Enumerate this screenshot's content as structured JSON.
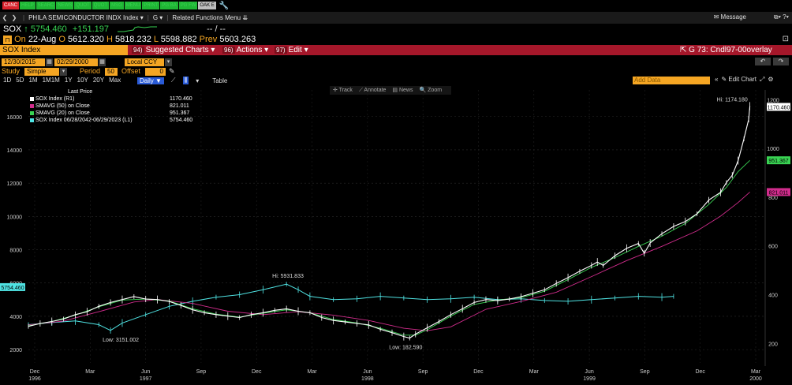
{
  "fkeys": [
    {
      "label": "CANC",
      "color": "red"
    },
    {
      "label": "HELP",
      "color": "green"
    },
    {
      "label": "SEARC",
      "color": "green"
    },
    {
      "label": "NEWS",
      "color": "green"
    },
    {
      "label": "QUOT",
      "color": "green"
    },
    {
      "label": "QUOT",
      "color": "green"
    },
    {
      "label": "MSG",
      "color": "green"
    },
    {
      "label": "MENU",
      "color": "green"
    },
    {
      "label": "PRINT",
      "color": "green"
    },
    {
      "label": "PG BA",
      "color": "green"
    },
    {
      "label": "PG FW",
      "color": "green"
    },
    {
      "label": "OAK E",
      "color": "grey"
    }
  ],
  "menubar": {
    "security": "PHILA SEMICONDUCTOR INDX Index ▾",
    "g_menu": "G ▾",
    "related": "Related Functions Menu ⇊",
    "message": "Message",
    "window_icons": "⧉▾ ?▾"
  },
  "ticker": {
    "symbol": "SOX",
    "arrow": "↑",
    "last": "5754.460",
    "change": "+151.197",
    "bid_ask": "-- / --",
    "on_label": "On",
    "date": "22-Aug",
    "o_label": "O",
    "open": "5612.320",
    "h_label": "H",
    "high": "5818.232",
    "l_label": "L",
    "low": "5598.882",
    "prev_label": "Prev",
    "prev": "5603.263"
  },
  "toolbar": {
    "security_name": "SOX Index",
    "btn1_num": "94)",
    "btn1": "Suggested Charts ▾",
    "btn2_num": "96)",
    "btn2": "Actions ▾",
    "btn3_num": "97)",
    "btn3": "Edit ▾",
    "chart_id": "G 73: Cndl97-00overlay"
  },
  "daterow": {
    "start": "12/30/2015",
    "end": "02/29/2000",
    "currency": "Local CCY"
  },
  "studyrow": {
    "study_label": "Study",
    "study": "Simple MA",
    "period_label": "Period",
    "period": "50",
    "offset_label": "Offset",
    "offset": "0"
  },
  "periods": [
    "1D",
    "5D",
    "1M",
    "1M1M",
    "1Y",
    "10Y",
    "20Y",
    "Max"
  ],
  "frequency": "Daily ▼",
  "table_label": "Table",
  "add_data": "Add Data",
  "edit_chart": "Edit Chart",
  "tools": [
    "✛ Track",
    "⟋ Annotate",
    "▤ News",
    "🔍 Zoom"
  ],
  "legend": {
    "title": "Last Price",
    "rows": [
      {
        "name": "SOX Index (R1)",
        "value": "1170.460",
        "color": "#ffffff"
      },
      {
        "name": "SMAVG (50) on Close",
        "value": "821.011",
        "color": "#d12c8c"
      },
      {
        "name": "SMAVG (20) on Close",
        "value": "951.367",
        "color": "#39d353"
      },
      {
        "name": "SOX Index 06/28/2042-06/29/2023 (L1)",
        "value": "5754.460",
        "color": "#4fe3e3"
      }
    ]
  },
  "chart_data": {
    "type": "line",
    "left_axis": {
      "ticks": [
        2000,
        4000,
        6000,
        8000,
        10000,
        12000,
        14000,
        16000
      ],
      "range": [
        1200,
        17600
      ],
      "current": "5754.460",
      "current_value": 5754.46
    },
    "right_axis": {
      "ticks": [
        200,
        400,
        600,
        800,
        1000,
        1200
      ],
      "range": [
        120,
        1240
      ],
      "tags": [
        {
          "label": "1170.460",
          "value": 1170.46,
          "color": "#ffffff"
        },
        {
          "label": "951.367",
          "value": 951.367,
          "color": "#39d353"
        },
        {
          "label": "821.011",
          "value": 821.011,
          "color": "#d12c8c"
        }
      ]
    },
    "x_labels": [
      {
        "m": "Dec",
        "y": "1996"
      },
      {
        "m": "Mar",
        "y": ""
      },
      {
        "m": "Jun",
        "y": "1997"
      },
      {
        "m": "Sep",
        "y": ""
      },
      {
        "m": "Dec",
        "y": ""
      },
      {
        "m": "Mar",
        "y": ""
      },
      {
        "m": "Jun",
        "y": "1998"
      },
      {
        "m": "Sep",
        "y": ""
      },
      {
        "m": "Dec",
        "y": ""
      },
      {
        "m": "Mar",
        "y": ""
      },
      {
        "m": "Jun",
        "y": "1999"
      },
      {
        "m": "Sep",
        "y": ""
      },
      {
        "m": "Dec",
        "y": ""
      },
      {
        "m": "Mar",
        "y": "2000"
      }
    ],
    "series": [
      {
        "name": "SOX Index (R1)",
        "axis": "right",
        "color": "#ffffff",
        "values": [
          [
            0,
            270
          ],
          [
            2,
            282
          ],
          [
            4,
            290
          ],
          [
            6,
            300
          ],
          [
            8,
            318
          ],
          [
            10,
            330
          ],
          [
            12,
            352
          ],
          [
            14,
            368
          ],
          [
            16,
            380
          ],
          [
            18,
            392
          ],
          [
            20,
            382
          ],
          [
            22,
            380
          ],
          [
            24,
            372
          ],
          [
            26,
            356
          ],
          [
            28,
            338
          ],
          [
            30,
            326
          ],
          [
            32,
            318
          ],
          [
            34,
            312
          ],
          [
            36,
            306
          ],
          [
            38,
            318
          ],
          [
            40,
            326
          ],
          [
            42,
            336
          ],
          [
            44,
            342
          ],
          [
            46,
            332
          ],
          [
            48,
            326
          ],
          [
            50,
            306
          ],
          [
            52,
            294
          ],
          [
            54,
            288
          ],
          [
            56,
            282
          ],
          [
            58,
            276
          ],
          [
            60,
            258
          ],
          [
            62,
            244
          ],
          [
            64,
            228
          ],
          [
            65,
            222
          ],
          [
            66,
            238
          ],
          [
            68,
            264
          ],
          [
            70,
            290
          ],
          [
            72,
            318
          ],
          [
            74,
            342
          ],
          [
            76,
            368
          ],
          [
            78,
            380
          ],
          [
            80,
            376
          ],
          [
            82,
            382
          ],
          [
            84,
            392
          ],
          [
            86,
            406
          ],
          [
            88,
            420
          ],
          [
            90,
            446
          ],
          [
            92,
            470
          ],
          [
            94,
            496
          ],
          [
            96,
            520
          ],
          [
            97,
            534
          ],
          [
            98,
            520
          ],
          [
            100,
            560
          ],
          [
            102,
            590
          ],
          [
            104,
            610
          ],
          [
            105,
            570
          ],
          [
            106,
            612
          ],
          [
            108,
            650
          ],
          [
            110,
            680
          ],
          [
            112,
            700
          ],
          [
            114,
            732
          ],
          [
            116,
            788
          ],
          [
            118,
            820
          ],
          [
            119,
            860
          ],
          [
            120,
            890
          ],
          [
            121,
            950
          ],
          [
            122,
            1040
          ],
          [
            122.8,
            1120
          ],
          [
            123,
            1174
          ]
        ]
      },
      {
        "name": "SMAVG (20) on Close",
        "axis": "right",
        "color": "#39d353",
        "values": [
          [
            0,
            272
          ],
          [
            4,
            290
          ],
          [
            8,
            316
          ],
          [
            12,
            350
          ],
          [
            16,
            378
          ],
          [
            20,
            382
          ],
          [
            24,
            374
          ],
          [
            28,
            342
          ],
          [
            32,
            320
          ],
          [
            36,
            308
          ],
          [
            40,
            324
          ],
          [
            44,
            338
          ],
          [
            48,
            326
          ],
          [
            52,
            298
          ],
          [
            56,
            284
          ],
          [
            60,
            262
          ],
          [
            64,
            234
          ],
          [
            66,
            234
          ],
          [
            68,
            256
          ],
          [
            72,
            312
          ],
          [
            76,
            360
          ],
          [
            80,
            378
          ],
          [
            84,
            388
          ],
          [
            88,
            414
          ],
          [
            92,
            462
          ],
          [
            96,
            512
          ],
          [
            100,
            552
          ],
          [
            104,
            598
          ],
          [
            108,
            640
          ],
          [
            112,
            692
          ],
          [
            116,
            770
          ],
          [
            119,
            840
          ],
          [
            121,
            905
          ],
          [
            123,
            951
          ]
        ]
      },
      {
        "name": "SMAVG (50) on Close",
        "axis": "right",
        "color": "#d12c8c",
        "values": [
          [
            0,
            276
          ],
          [
            6,
            292
          ],
          [
            12,
            330
          ],
          [
            18,
            370
          ],
          [
            22,
            380
          ],
          [
            28,
            364
          ],
          [
            34,
            332
          ],
          [
            40,
            318
          ],
          [
            46,
            330
          ],
          [
            52,
            316
          ],
          [
            58,
            294
          ],
          [
            64,
            262
          ],
          [
            68,
            252
          ],
          [
            72,
            268
          ],
          [
            78,
            340
          ],
          [
            84,
            372
          ],
          [
            90,
            410
          ],
          [
            96,
            474
          ],
          [
            102,
            540
          ],
          [
            108,
            598
          ],
          [
            114,
            662
          ],
          [
            118,
            722
          ],
          [
            121,
            778
          ],
          [
            123,
            821
          ]
        ]
      },
      {
        "name": "SOX Index 06/28/2042-06/29/2023 (L1)",
        "axis": "left",
        "color": "#4fe3e3",
        "values": [
          [
            0,
            3500
          ],
          [
            4,
            3620
          ],
          [
            8,
            3720
          ],
          [
            12,
            3500
          ],
          [
            14,
            3151
          ],
          [
            16,
            3600
          ],
          [
            20,
            4100
          ],
          [
            24,
            4600
          ],
          [
            28,
            4900
          ],
          [
            32,
            5150
          ],
          [
            36,
            5300
          ],
          [
            40,
            5600
          ],
          [
            44,
            5931
          ],
          [
            46,
            5600
          ],
          [
            48,
            5200
          ],
          [
            52,
            5000
          ],
          [
            56,
            5050
          ],
          [
            60,
            5200
          ],
          [
            64,
            5100
          ],
          [
            68,
            5000
          ],
          [
            72,
            5050
          ],
          [
            76,
            5150
          ],
          [
            80,
            5000
          ],
          [
            84,
            5050
          ],
          [
            88,
            4950
          ],
          [
            92,
            4900
          ],
          [
            96,
            5000
          ],
          [
            100,
            5100
          ],
          [
            104,
            5200
          ],
          [
            108,
            5150
          ],
          [
            110,
            5200
          ]
        ]
      }
    ],
    "annotations": [
      {
        "text": "Hi: 1174.180",
        "axis": "right",
        "x": 123,
        "y": 1174,
        "dx": -42,
        "dy": -6
      },
      {
        "text": "Hi: 5931.833",
        "axis": "left",
        "x": 44,
        "y": 5931,
        "dx": -18,
        "dy": -8
      },
      {
        "text": "Low: 3151.002",
        "axis": "left",
        "x": 14,
        "y": 3151,
        "dx": -10,
        "dy": 14
      },
      {
        "text": "Low: 182.590",
        "axis": "right",
        "x": 65,
        "y": 222,
        "dx": -26,
        "dy": 14
      }
    ]
  }
}
